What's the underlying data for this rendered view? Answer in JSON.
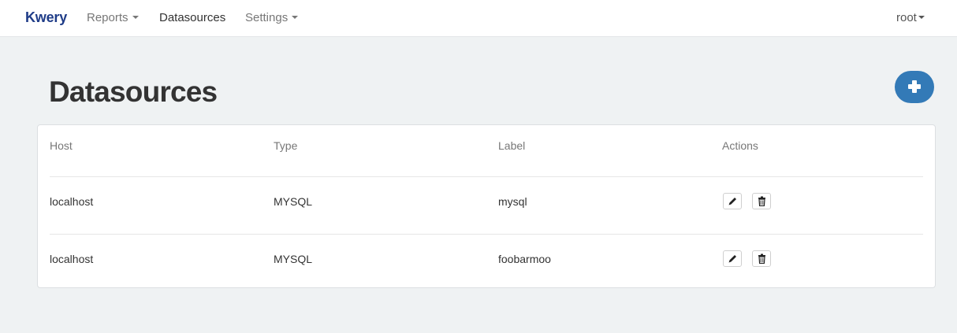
{
  "nav": {
    "brand": "Kwery",
    "items": [
      {
        "label": "Reports",
        "dropdown": true
      },
      {
        "label": "Datasources",
        "active": true
      },
      {
        "label": "Settings",
        "dropdown": true
      }
    ],
    "user": "root"
  },
  "page": {
    "title": "Datasources",
    "add_icon": "plus-icon"
  },
  "table": {
    "columns": [
      "Host",
      "Type",
      "Label",
      "Actions"
    ],
    "rows": [
      {
        "host": "localhost",
        "type": "MYSQL",
        "label": "mysql"
      },
      {
        "host": "localhost",
        "type": "MYSQL",
        "label": "foobarmoo"
      }
    ],
    "action_icons": [
      "pencil-icon",
      "trash-icon"
    ]
  },
  "colors": {
    "brand": "#1f3c88",
    "accent": "#337ab7",
    "background": "#eff2f3"
  }
}
